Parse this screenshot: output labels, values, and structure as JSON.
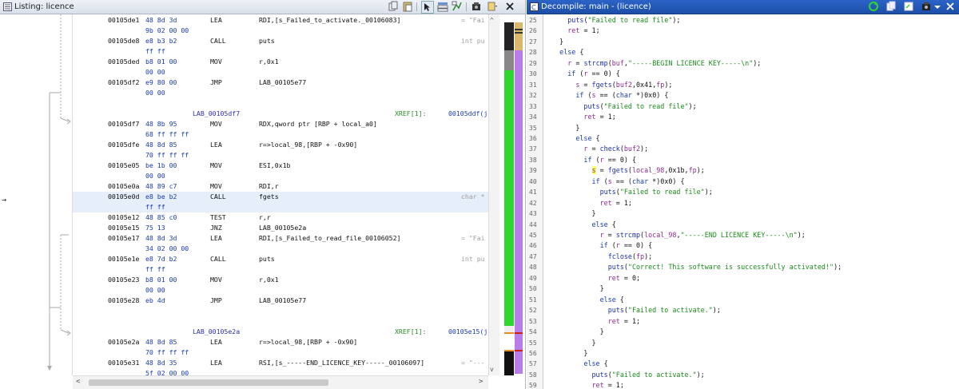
{
  "listing": {
    "title": "Listing:  licence",
    "rows": [
      {
        "addr": "00105de1",
        "bytes": "48 8d 3d",
        "mnem": "LEA",
        "op": "RDI,[s_Failed_to_activate._00106083]",
        "cmt": "= \"Fai"
      },
      {
        "bytes": "9b 02 00 00"
      },
      {
        "addr": "00105de8",
        "bytes": "e8 b3 b2",
        "mnem": "CALL",
        "op": "puts",
        "cmt": "int pu"
      },
      {
        "bytes": "ff ff"
      },
      {
        "addr": "00105ded",
        "bytes": "b8 01 00",
        "mnem": "MOV",
        "op": "r,0x1"
      },
      {
        "bytes": "00 00"
      },
      {
        "addr": "00105df2",
        "bytes": "e9 80 00",
        "mnem": "JMP",
        "op": "LAB_00105e77"
      },
      {
        "bytes": "00 00"
      },
      {
        "blank": true
      },
      {
        "label": "LAB_00105df7",
        "xref": "XREF[1]:",
        "xrefv": "00105ddf(j"
      },
      {
        "addr": "00105df7",
        "bytes": "48 8b 95",
        "mnem": "MOV",
        "op": "RDX,qword ptr [RBP + local_a0]"
      },
      {
        "bytes": "68 ff ff ff"
      },
      {
        "addr": "00105dfe",
        "bytes": "48 8d 85",
        "mnem": "LEA",
        "op": "r=>local_98,[RBP + -0x90]"
      },
      {
        "bytes": "70 ff ff ff"
      },
      {
        "addr": "00105e05",
        "bytes": "be 1b 00",
        "mnem": "MOV",
        "op": "ESI,0x1b"
      },
      {
        "bytes": "00 00"
      },
      {
        "addr": "00105e0a",
        "bytes": "48 89 c7",
        "mnem": "MOV",
        "op": "RDI,r"
      },
      {
        "addr": "00105e0d",
        "bytes": "e8 be b2",
        "mnem": "CALL",
        "op": "fgets",
        "cmt": "char *",
        "hl": true
      },
      {
        "bytes": "ff ff",
        "hl": true
      },
      {
        "addr": "00105e12",
        "bytes": "48 85 c0",
        "mnem": "TEST",
        "op": "r,r"
      },
      {
        "addr": "00105e15",
        "bytes": "75 13",
        "mnem": "JNZ",
        "op": "LAB_00105e2a"
      },
      {
        "addr": "00105e17",
        "bytes": "48 8d 3d",
        "mnem": "LEA",
        "op": "RDI,[s_Failed_to_read_file_00106052]",
        "cmt": "= \"Fai"
      },
      {
        "bytes": "34 02 00 00"
      },
      {
        "addr": "00105e1e",
        "bytes": "e8 7d b2",
        "mnem": "CALL",
        "op": "puts",
        "cmt": "int pu"
      },
      {
        "bytes": "ff ff"
      },
      {
        "addr": "00105e23",
        "bytes": "b8 01 00",
        "mnem": "MOV",
        "op": "r,0x1"
      },
      {
        "bytes": "00 00"
      },
      {
        "addr": "00105e28",
        "bytes": "eb 4d",
        "mnem": "JMP",
        "op": "LAB_00105e77"
      },
      {
        "blank": true
      },
      {
        "blank": true
      },
      {
        "label": "LAB_00105e2a",
        "xref": "XREF[1]:",
        "xrefv": "00105e15(j"
      },
      {
        "addr": "00105e2a",
        "bytes": "48 8d 85",
        "mnem": "LEA",
        "op": "r=>local_98,[RBP + -0x90]"
      },
      {
        "bytes": "70 ff ff ff"
      },
      {
        "addr": "00105e31",
        "bytes": "48 8d 35",
        "mnem": "LEA",
        "op": "RSI,[s_-----END_LICENCE_KEY-----_00106097]",
        "cmt": "= \"---"
      },
      {
        "bytes": "5f 02 00 00"
      }
    ]
  },
  "decompile": {
    "title": "Decompile: main -  (licence)",
    "lines": [
      {
        "n": "25",
        "t": "      puts(\"Failed to read file\");"
      },
      {
        "n": "26",
        "t": "      ret = 1;"
      },
      {
        "n": "27",
        "t": "    }"
      },
      {
        "n": "28",
        "t": "    else {"
      },
      {
        "n": "29",
        "t": "      r = strcmp(buf,\"-----BEGIN LICENCE KEY-----\\n\");"
      },
      {
        "n": "30",
        "t": "      if (r == 0) {"
      },
      {
        "n": "31",
        "t": "        s = fgets(buf2,0x41,fp);"
      },
      {
        "n": "32",
        "t": "        if (s == (char *)0x0) {"
      },
      {
        "n": "33",
        "t": "          puts(\"Failed to read file\");"
      },
      {
        "n": "34",
        "t": "          ret = 1;"
      },
      {
        "n": "35",
        "t": "        }"
      },
      {
        "n": "36",
        "t": "        else {"
      },
      {
        "n": "37",
        "t": "          r = check(buf2);"
      },
      {
        "n": "38",
        "t": "          if (r == 0) {"
      },
      {
        "n": "39",
        "t": "            s = fgets(local_98,0x1b,fp);"
      },
      {
        "n": "40",
        "t": "            if (s == (char *)0x0) {"
      },
      {
        "n": "41",
        "t": "              puts(\"Failed to read file\");"
      },
      {
        "n": "42",
        "t": "              ret = 1;"
      },
      {
        "n": "43",
        "t": "            }"
      },
      {
        "n": "44",
        "t": "            else {"
      },
      {
        "n": "45",
        "t": "              r = strcmp(local_98,\"-----END LICENCE KEY-----\\n\");"
      },
      {
        "n": "46",
        "t": "              if (r == 0) {"
      },
      {
        "n": "47",
        "t": "                fclose(fp);"
      },
      {
        "n": "48",
        "t": "                puts(\"Correct! This software is successfully activated!\");"
      },
      {
        "n": "49",
        "t": "                ret = 0;"
      },
      {
        "n": "50",
        "t": "              }"
      },
      {
        "n": "51",
        "t": "              else {"
      },
      {
        "n": "52",
        "t": "                puts(\"Failed to activate.\");"
      },
      {
        "n": "53",
        "t": "                ret = 1;"
      },
      {
        "n": "54",
        "t": "              }"
      },
      {
        "n": "55",
        "t": "            }"
      },
      {
        "n": "56",
        "t": "          }"
      },
      {
        "n": "57",
        "t": "          else {"
      },
      {
        "n": "58",
        "t": "            puts(\"Failed to activate.\");"
      },
      {
        "n": "59",
        "t": "            ret = 1;"
      }
    ]
  },
  "icons": {
    "listing": [
      "copy-icon",
      "paste-icon",
      "cursor-icon",
      "diff-icon",
      "flow-icon",
      "snapshot-icon",
      "more-icon",
      "close-icon"
    ],
    "decompile": [
      "refresh-icon",
      "copy-icon",
      "export-icon",
      "snapshot-icon",
      "menu-icon",
      "close-icon"
    ]
  },
  "colors": {
    "overview_green": "#2fd62f",
    "overview_purple": "#b87de8",
    "title_blue": "#1f52ae",
    "highlight_yellow": "#ffff66"
  }
}
